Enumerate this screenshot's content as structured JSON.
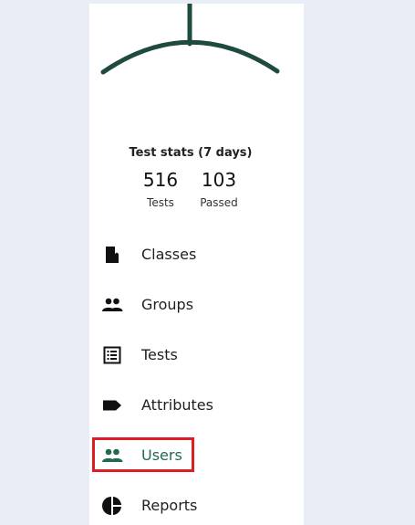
{
  "stats": {
    "title": "Test stats (7 days)",
    "tests_value": "516",
    "tests_label": "Tests",
    "passed_value": "103",
    "passed_label": "Passed"
  },
  "nav": {
    "items": [
      {
        "label": "Classes",
        "icon": "book-icon"
      },
      {
        "label": "Groups",
        "icon": "people-icon"
      },
      {
        "label": "Tests",
        "icon": "list-icon"
      },
      {
        "label": "Attributes",
        "icon": "label-icon"
      },
      {
        "label": "Users",
        "icon": "users-icon",
        "active": true
      },
      {
        "label": "Reports",
        "icon": "pie-chart-icon"
      }
    ]
  },
  "colors": {
    "background": "#e8edf6",
    "sidebar": "#ffffff",
    "logo": "#1e4a40",
    "active": "#1e6b4e",
    "highlight": "#e01b24"
  }
}
